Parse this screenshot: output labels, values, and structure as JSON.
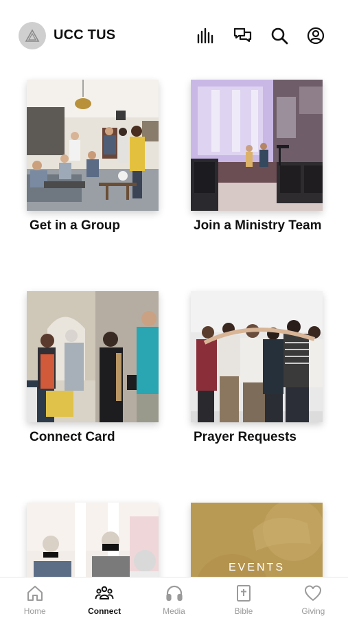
{
  "header": {
    "title": "UCC TUS",
    "icons": [
      "logo-icon",
      "bars-icon",
      "chat-icon",
      "search-icon",
      "profile-icon"
    ]
  },
  "cards": [
    {
      "label": "Get in a Group"
    },
    {
      "label": "Join a Ministry Team"
    },
    {
      "label": "Connect Card"
    },
    {
      "label": "Prayer Requests"
    },
    {
      "label": ""
    },
    {
      "label": "",
      "overlay_text": "EVENTS"
    }
  ],
  "tabbar": {
    "active": "Connect",
    "tabs": [
      {
        "label": "Home",
        "icon": "home-icon"
      },
      {
        "label": "Connect",
        "icon": "people-icon"
      },
      {
        "label": "Media",
        "icon": "headphones-icon"
      },
      {
        "label": "Bible",
        "icon": "bible-icon"
      },
      {
        "label": "Giving",
        "icon": "heart-icon"
      }
    ]
  },
  "colors": {
    "text": "#111111",
    "inactive_tab": "#9a9a9a",
    "events_card": "#b99a55"
  }
}
